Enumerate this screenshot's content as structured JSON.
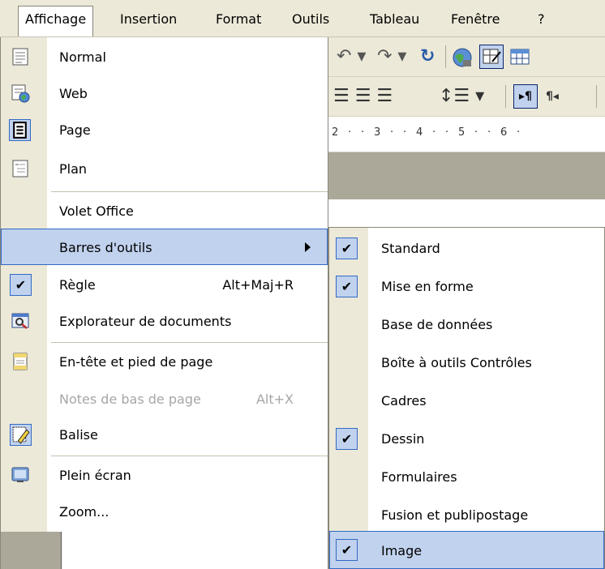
{
  "menubar": {
    "items": [
      {
        "label": "Affichage",
        "active": true
      },
      {
        "label": "Insertion"
      },
      {
        "label": "Format"
      },
      {
        "label": "Outils"
      },
      {
        "label": "Tableau"
      },
      {
        "label": "Fenêtre"
      },
      {
        "label": "?"
      }
    ]
  },
  "toolbar": {
    "undo_glyph": "↶ ▾",
    "redo_glyph": "↷ ▾",
    "refresh_glyph": "↻",
    "align_glyphs": "☰ ☰ ☰",
    "spacing_glyph": "↕☰ ▾",
    "ltr_glyph": "▸¶",
    "rtl_glyph": "¶◂"
  },
  "ruler": {
    "marks": [
      "2",
      "·",
      "·",
      "3",
      "·",
      "·",
      "4",
      "·",
      "·",
      "5",
      "·",
      "·",
      "6",
      "·"
    ]
  },
  "menu": {
    "items": [
      {
        "label": "Normal",
        "icon": "normal-view-icon"
      },
      {
        "label": "Web",
        "icon": "web-view-icon"
      },
      {
        "label": "Page",
        "icon": "page-view-icon",
        "state": "checked-icon"
      },
      {
        "label": "Plan",
        "icon": "outline-view-icon"
      },
      {
        "label": "Volet Office"
      },
      {
        "label": "Barres d'outils",
        "submenu": true,
        "highlighted": true
      },
      {
        "label": "Règle",
        "shortcut": "Alt+Maj+R",
        "checked": true
      },
      {
        "label": "Explorateur de documents",
        "icon": "document-map-icon"
      },
      {
        "label": "En-tête et pied de page",
        "icon": "header-footer-icon"
      },
      {
        "label": "Notes de bas de page",
        "shortcut": "Alt+X",
        "disabled": true
      },
      {
        "label": "Balise",
        "icon": "markup-icon",
        "state": "checked-icon"
      },
      {
        "label": "Plein écran",
        "icon": "full-screen-icon"
      },
      {
        "label": "Zoom..."
      }
    ]
  },
  "submenu": {
    "items": [
      {
        "label": "Standard",
        "checked": true
      },
      {
        "label": "Mise en forme",
        "checked": true
      },
      {
        "label": "Base de données",
        "checked": false
      },
      {
        "label": "Boîte à outils Contrôles",
        "checked": false
      },
      {
        "label": "Cadres",
        "checked": false
      },
      {
        "label": "Dessin",
        "checked": true
      },
      {
        "label": "Formulaires",
        "checked": false
      },
      {
        "label": "Fusion et publipostage",
        "checked": false
      },
      {
        "label": "Image",
        "checked": true,
        "highlighted": true
      }
    ]
  },
  "colors": {
    "menu_highlight": "#c1d2ee",
    "highlight_border": "#316ac5",
    "gutter": "#ece9d8"
  }
}
